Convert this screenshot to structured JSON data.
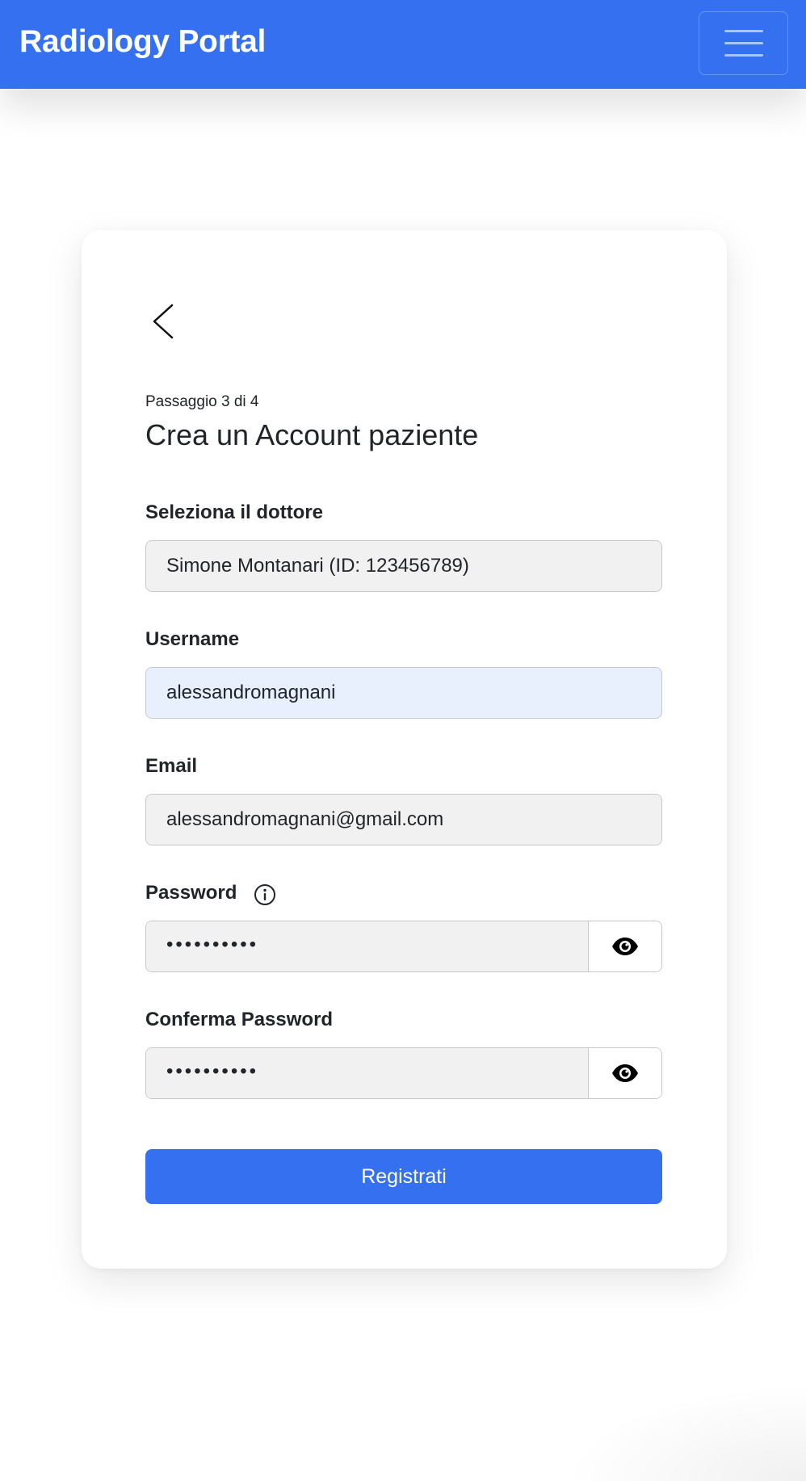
{
  "navbar": {
    "brand": "Radiology Portal",
    "menu_icon": "hamburger-menu-icon"
  },
  "form": {
    "back_icon": "chevron-left-icon",
    "step": "Passaggio 3 di 4",
    "title": "Crea un Account paziente",
    "doctor": {
      "label": "Seleziona il dottore",
      "value": "Simone Montanari (ID: 123456789)"
    },
    "username": {
      "label": "Username",
      "value": "alessandromagnani"
    },
    "email": {
      "label": "Email",
      "value": "alessandromagnani@gmail.com"
    },
    "password": {
      "label": "Password",
      "info_icon": "info-circle-icon",
      "value": "••••••••••",
      "toggle_icon": "eye-icon"
    },
    "confirm_password": {
      "label": "Conferma Password",
      "value": "••••••••••",
      "toggle_icon": "eye-icon"
    },
    "submit_label": "Registrati"
  },
  "colors": {
    "primary": "#3470f0",
    "field_bg": "#f1f1f1",
    "field_active_bg": "#e8f0fe",
    "field_border": "#c8c8c8",
    "text": "#212529"
  }
}
